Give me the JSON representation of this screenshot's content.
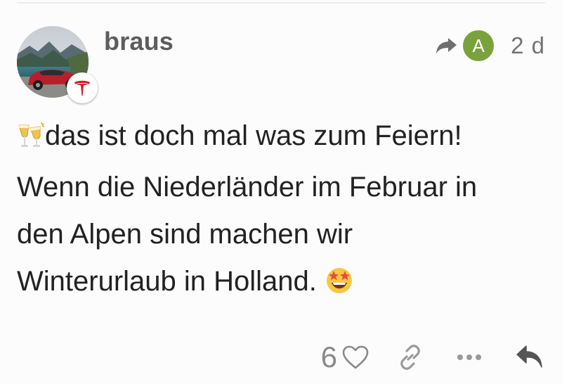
{
  "post": {
    "username": "braus",
    "reply_to_avatar_letter": "A",
    "reply_to_avatar_color": "#7aa23c",
    "date": "2 d",
    "body_lines": [
      "das ist doch mal was zum Feiern!",
      "Wenn die Niederländer im Februar in",
      "den Alpen sind machen wir",
      "Winterurlaub in Holland."
    ],
    "emojis": [
      "clinking-glasses-icon",
      "star-struck-icon"
    ],
    "user_flair": "tesla-logo-icon"
  },
  "actions": {
    "like_count": "6",
    "icons": [
      "heart-icon",
      "link-icon",
      "more-icon",
      "reply-icon"
    ]
  },
  "colors": {
    "accent_avatar": "#7aa23c",
    "flair_red": "#cc1f26",
    "text": "#222222",
    "muted": "#737373"
  }
}
